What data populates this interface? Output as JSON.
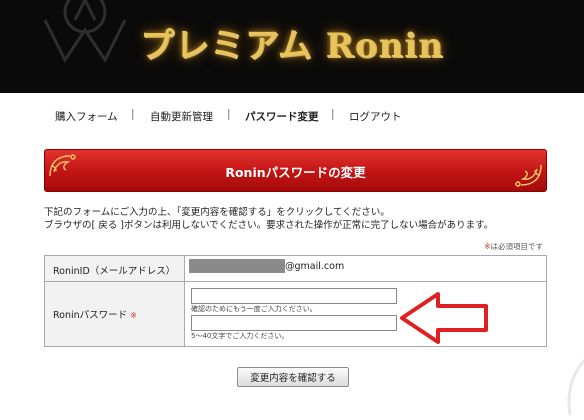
{
  "header": {
    "logo_text": "プレミアム Ronin"
  },
  "nav": {
    "items": [
      {
        "label": "購入フォーム",
        "active": false
      },
      {
        "label": "自動更新管理",
        "active": false
      },
      {
        "label": "パスワード変更",
        "active": true
      },
      {
        "label": "ログアウト",
        "active": false
      }
    ],
    "separator": "|"
  },
  "panel": {
    "title": "Roninパスワードの変更"
  },
  "description": {
    "line1": "下記のフォームにご入力の上、「変更内容を確認する」をクリックしてください。",
    "line2": "ブラウザの[ 戻る ]ボタンは利用しないでください。要求された操作が正常に完了しない場合があります。"
  },
  "required_note": {
    "mark": "※",
    "text": "は必須項目です"
  },
  "form": {
    "email_row": {
      "label": "RoninID（メールアドレス）",
      "value_suffix": "@gmail.com"
    },
    "password_row": {
      "label": "Roninパスワード",
      "required_mark": "※",
      "password_value": "",
      "confirm_hint": "確認のためにもう一度ご入力ください。",
      "confirm_value": "",
      "length_hint": "5～40文字でご入力ください。"
    }
  },
  "submit": {
    "label": "変更内容を確認する"
  },
  "colors": {
    "banner_bg": "#0a0a0a",
    "logo_gold": "#e8c45a",
    "title_red": "#c01414",
    "required_red": "#e03030",
    "arrow_red": "#e02020"
  }
}
